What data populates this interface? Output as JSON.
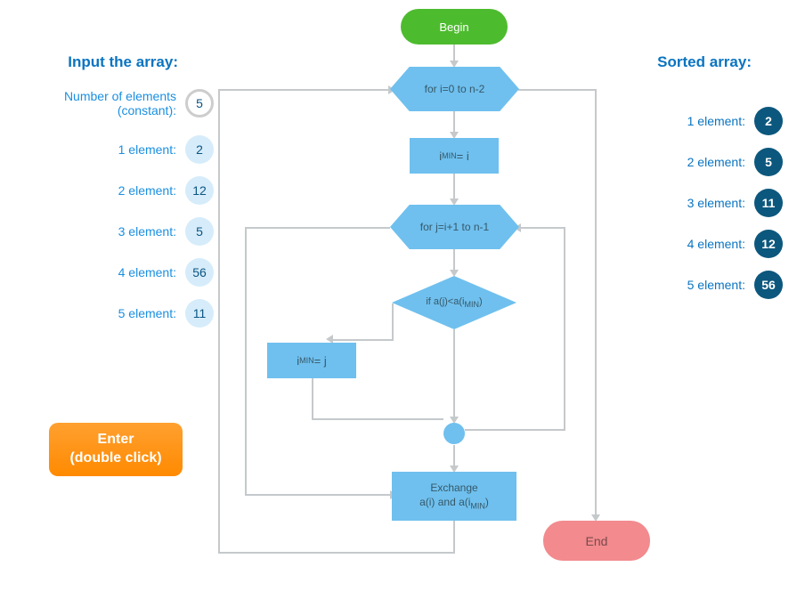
{
  "input": {
    "title": "Input the array:",
    "num_label": "Number of elements (constant):",
    "num_value": "5",
    "elements": [
      {
        "label": "1 element:",
        "value": "2"
      },
      {
        "label": "2 element:",
        "value": "12"
      },
      {
        "label": "3 element:",
        "value": "5"
      },
      {
        "label": "4 element:",
        "value": "56"
      },
      {
        "label": "5 element:",
        "value": "11"
      }
    ]
  },
  "sorted": {
    "title": "Sorted array:",
    "elements": [
      {
        "label": "1 element:",
        "value": "2"
      },
      {
        "label": "2 element:",
        "value": "5"
      },
      {
        "label": "3 element:",
        "value": "11"
      },
      {
        "label": "4 element:",
        "value": "12"
      },
      {
        "label": "5 element:",
        "value": "56"
      }
    ]
  },
  "button": {
    "line1": "Enter",
    "line2": "(double click)"
  },
  "flow": {
    "begin": "Begin",
    "loop1": "for i=0 to n-2",
    "assign_imin_i_left": "i",
    "assign_imin_i_sub": "MIN",
    "assign_imin_i_right": " = i",
    "loop2": "for j=i+1 to n-1",
    "cond_left": "if a(j)<a(i",
    "cond_sub": "MIN",
    "cond_right": ")",
    "assign_imin_j_left": "i",
    "assign_imin_j_sub": "MIN",
    "assign_imin_j_right": " = j",
    "exchange_line1": "Exchange",
    "exchange_left": "a(i) and a(i",
    "exchange_sub": "MIN",
    "exchange_right": ")",
    "end": "End"
  }
}
